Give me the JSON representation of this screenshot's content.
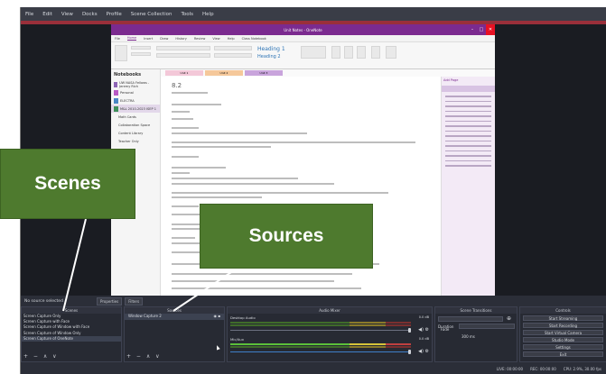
{
  "menu": [
    "File",
    "Edit",
    "View",
    "Docks",
    "Profile",
    "Scene Collection",
    "Tools",
    "Help"
  ],
  "onenote": {
    "title": "Unit Notes - OneNote",
    "tabs": [
      "File",
      "Home",
      "Insert",
      "Draw",
      "History",
      "Review",
      "View",
      "Help",
      "Class Notebook"
    ],
    "styles": [
      "Heading 1",
      "Heading 2"
    ],
    "notebooks_header": "Notebooks",
    "notebook_items": [
      "UW NASA Fellows - Jeremy Rich",
      "Personal",
      "ELECTRA",
      "M&L 2010-2023 ISEP 1",
      "Math Cards",
      "Collaboration Space",
      "Content Library",
      "Teacher Only"
    ],
    "section_tabs": [
      "Unit 1",
      "Unit 2",
      "Unit 3"
    ],
    "page_title": "8.2",
    "add_page": "Add Page",
    "pages": [
      "8.1",
      "8.2",
      "8.3"
    ]
  },
  "status": {
    "no_source": "No source selected",
    "properties": "Properties",
    "filters": "Filters"
  },
  "docks": {
    "scenes": "Scenes",
    "sources": "Sources",
    "mixer": "Audio Mixer",
    "transitions": "Scene Transitions",
    "controls": "Controls"
  },
  "scenes": [
    "Screen Capture Only",
    "Screen Capture with Face",
    "Screen Capture of Window with Face",
    "Screen Capture of Window Only",
    "Screen Capture of OneNote"
  ],
  "sources": [
    "Window Capture 2"
  ],
  "mixer": [
    {
      "name": "Desktop Audio",
      "db": "0.0 dB"
    },
    {
      "name": "Mic/Aux",
      "db": "0.0 dB"
    }
  ],
  "transitions": {
    "type": "Fade",
    "duration_label": "Duration",
    "duration": "300 ms"
  },
  "controls": [
    "Start Streaming",
    "Start Recording",
    "Start Virtual Camera",
    "Studio Mode",
    "Settings",
    "Exit"
  ],
  "bottom": {
    "live": "LIVE: 00:00:00",
    "rec": "REC: 00:00:00",
    "cpu": "CPU: 2.9%, 30.00 fps"
  },
  "callouts": {
    "scenes": "Scenes",
    "sources": "Sources"
  },
  "dock_footer": "+ − ∧ ∨",
  "colors": {
    "callout": "#4e7a2e",
    "obs_bg": "#2b2e38",
    "onenote_purple": "#7b2a8f"
  }
}
